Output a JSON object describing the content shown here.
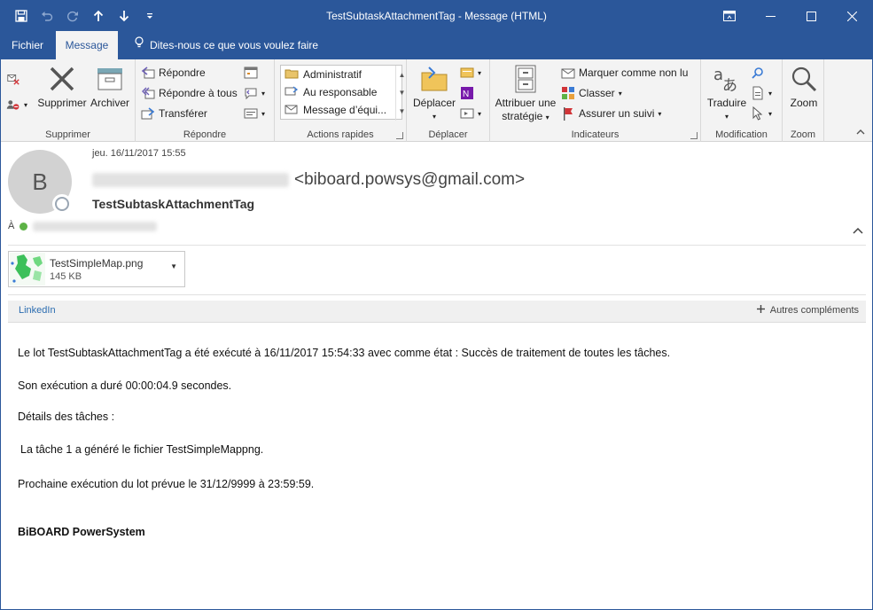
{
  "window": {
    "title": "TestSubtaskAttachmentTag  -  Message (HTML)",
    "controls": {
      "restore_icon": "restore-ribbon-icon",
      "minimize": "minimize-icon",
      "maximize": "maximize-icon",
      "close": "close-icon"
    }
  },
  "qat": {
    "save": "save-icon",
    "undo": "undo-icon",
    "redo": "redo-icon",
    "up": "arrow-up-icon",
    "down": "arrow-down-icon",
    "customize": "customize-icon"
  },
  "tabs": {
    "file": "Fichier",
    "message": "Message",
    "tell_me": "Dites-nous ce que vous voulez faire"
  },
  "ribbon": {
    "delete_group": {
      "label": "Supprimer",
      "delete": "Supprimer",
      "archive": "Archiver"
    },
    "respond_group": {
      "label": "Répondre",
      "reply": "Répondre",
      "reply_all": "Répondre à tous",
      "forward": "Transférer"
    },
    "quick_steps": {
      "label": "Actions rapides",
      "items": [
        "Administratif",
        "Au responsable",
        "Message d’équi..."
      ]
    },
    "move_group": {
      "label": "Déplacer",
      "move": "Déplacer"
    },
    "tags_group": {
      "label": "Indicateurs",
      "assign_policy_line1": "Attribuer une",
      "assign_policy_line2": "stratégie",
      "mark_unread": "Marquer comme non lu",
      "categorize": "Classer",
      "follow_up": "Assurer un suivi"
    },
    "editing_group": {
      "label": "Modification",
      "translate": "Traduire"
    },
    "zoom_group": {
      "label": "Zoom",
      "zoom": "Zoom"
    }
  },
  "message": {
    "avatar_letter": "B",
    "date": "jeu. 16/11/2017 15:55",
    "from_email": "<biboard.powsys@gmail.com>",
    "subject": "TestSubtaskAttachmentTag",
    "to_label": "À"
  },
  "attachment": {
    "name": "TestSimpleMap.png",
    "size": "145 KB"
  },
  "addins": {
    "linkedin": "LinkedIn",
    "more": "Autres compléments"
  },
  "body": {
    "line1": "Le lot TestSubtaskAttachmentTag a été exécuté à 16/11/2017 15:54:33 avec comme état : Succès de traitement de toutes les tâches.",
    "line2": "Son exécution a duré 00:00:04.9 secondes.",
    "line3": "Détails des tâches :",
    "line4": "La tâche 1 a généré le fichier TestSimpleMappng.",
    "line5": "Prochaine exécution du lot prévue le 31/12/9999 à 23:59:59.",
    "signature": "BiBOARD PowerSystem"
  },
  "colors": {
    "accent": "#2b579a",
    "ribbon_bg": "#f3f3f3",
    "link": "#2b6cb0",
    "presence_green": "#5db246",
    "flag_red": "#d13438"
  }
}
